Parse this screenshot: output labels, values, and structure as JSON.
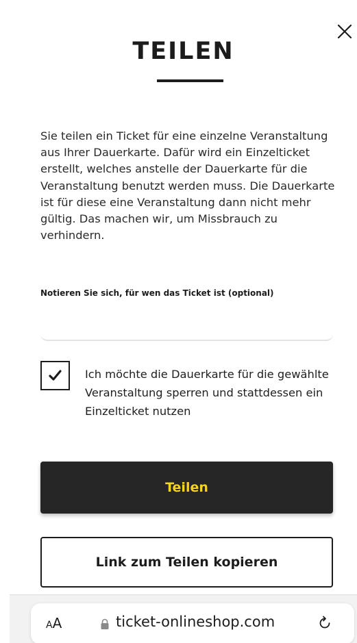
{
  "modal": {
    "title": "TEILEN",
    "description": "Sie teilen ein Ticket für eine einzelne Veranstaltung aus Ihrer Dauerkarte. Dafür wird ein Einzelticket erstellt, welches anstelle der Dauerkarte für die Veranstaltung benutzt werden muss. Die Dauerkarte ist für diese eine Veranstaltung dann nicht mehr gültig. Das machen wir, um Missbrauch zu verhindern.",
    "note_label": "Notieren Sie sich, für wen das Ticket ist (optional)",
    "note_value": "",
    "checkbox_checked": true,
    "checkbox_label": "Ich möchte die Dauerkarte für die gewählte Veranstaltung sperren und stattdessen ein Einzelticket nutzen",
    "share_button": "Teilen",
    "copy_button": "Link zum Teilen kopieren",
    "close_icon": "close-icon"
  },
  "browser": {
    "text_size_button": "AA",
    "url": "ticket-onlineshop.com",
    "lock_icon": "lock-icon",
    "reload_icon": "reload-icon"
  },
  "colors": {
    "share_button_bg": "#262626",
    "share_button_text": "#f5d21e"
  }
}
